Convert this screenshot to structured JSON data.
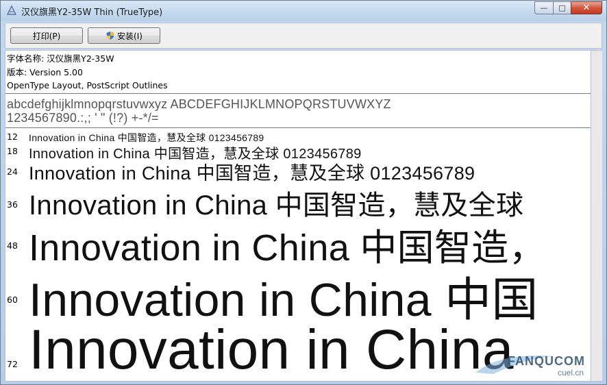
{
  "window": {
    "title": "汉仪旗黑Y2-35W Thin (TrueType)",
    "minimize_glyph": "—",
    "maximize_glyph": "□",
    "close_glyph": "✕"
  },
  "toolbar": {
    "print_label": "打印(P)",
    "install_label": "安装(I)"
  },
  "info": {
    "font_name": "字体名称: 汉仪旗黑Y2-35W",
    "version": "版本: Version 5.00",
    "outlines": "OpenType Layout, PostScript Outlines"
  },
  "charset": {
    "line1": "abcdefghijklmnopqrstuvwxyz ABCDEFGHIJKLMNOPQRSTUVWXYZ",
    "line2": "1234567890.:,; ' \" (!?) +-*/="
  },
  "samples": [
    {
      "size": "12",
      "text": "Innovation in China 中国智造，慧及全球 0123456789"
    },
    {
      "size": "18",
      "text": "Innovation in China 中国智造，慧及全球 0123456789"
    },
    {
      "size": "24",
      "text": "Innovation in China 中国智造，慧及全球 0123456789"
    },
    {
      "size": "36",
      "text": "Innovation in China 中国智造，慧及全球"
    },
    {
      "size": "48",
      "text": "Innovation in China 中国智造，"
    },
    {
      "size": "60",
      "text": "Innovation in China 中国"
    },
    {
      "size": "72",
      "text": "Innovation in China"
    }
  ],
  "watermark": {
    "brand": "FANQUCOM",
    "sub": "cuel.cn"
  },
  "colors": {
    "close_button": "#c23b21",
    "title_bar": "#c8dbf0",
    "content_bg": "#ffffff"
  }
}
